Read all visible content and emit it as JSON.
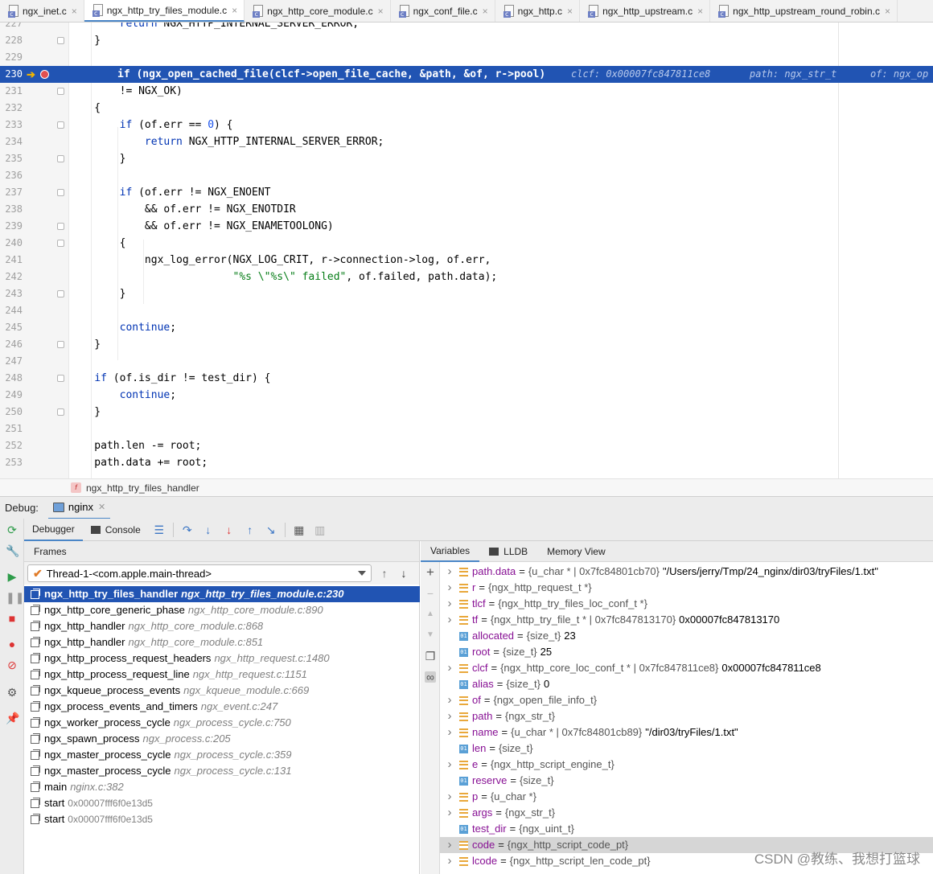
{
  "tabs": [
    {
      "label": "ngx_inet.c",
      "active": false
    },
    {
      "label": "ngx_http_try_files_module.c",
      "active": true
    },
    {
      "label": "ngx_http_core_module.c",
      "active": false
    },
    {
      "label": "ngx_conf_file.c",
      "active": false
    },
    {
      "label": "ngx_http.c",
      "active": false
    },
    {
      "label": "ngx_http_upstream.c",
      "active": false
    },
    {
      "label": "ngx_http_upstream_round_robin.c",
      "active": false
    }
  ],
  "editor": {
    "current_line": "230",
    "current_code": "if (ngx_open_cached_file(clcf->open_file_cache, &path, &of, r->pool)",
    "inline_values": [
      "clcf: 0x00007fc847811ce8",
      "path: ngx_str_t",
      "of: ngx_op"
    ],
    "lines": [
      {
        "n": "227",
        "text": "        return NGX_HTTP_INTERNAL_SERVER_ERROR;"
      },
      {
        "n": "228",
        "text": "    }"
      },
      {
        "n": "229",
        "text": ""
      },
      {
        "n": "230",
        "text": ""
      },
      {
        "n": "231",
        "text": "        != NGX_OK)"
      },
      {
        "n": "232",
        "text": "    {"
      },
      {
        "n": "233",
        "text": "        if (of.err == 0) {"
      },
      {
        "n": "234",
        "text": "            return NGX_HTTP_INTERNAL_SERVER_ERROR;"
      },
      {
        "n": "235",
        "text": "        }"
      },
      {
        "n": "236",
        "text": ""
      },
      {
        "n": "237",
        "text": "        if (of.err != NGX_ENOENT"
      },
      {
        "n": "238",
        "text": "            && of.err != NGX_ENOTDIR"
      },
      {
        "n": "239",
        "text": "            && of.err != NGX_ENAMETOOLONG)"
      },
      {
        "n": "240",
        "text": "        {"
      },
      {
        "n": "241",
        "text": "            ngx_log_error(NGX_LOG_CRIT, r->connection->log, of.err,"
      },
      {
        "n": "242",
        "text": "                          \"%s \\\"%s\\\" failed\", of.failed, path.data);"
      },
      {
        "n": "243",
        "text": "        }"
      },
      {
        "n": "244",
        "text": ""
      },
      {
        "n": "245",
        "text": "        continue;"
      },
      {
        "n": "246",
        "text": "    }"
      },
      {
        "n": "247",
        "text": ""
      },
      {
        "n": "248",
        "text": "    if (of.is_dir != test_dir) {"
      },
      {
        "n": "249",
        "text": "        continue;"
      },
      {
        "n": "250",
        "text": "    }"
      },
      {
        "n": "251",
        "text": ""
      },
      {
        "n": "252",
        "text": "    path.len -= root;"
      },
      {
        "n": "253",
        "text": "    path.data += root;"
      }
    ]
  },
  "breadcrumb": {
    "icon": "f",
    "label": "ngx_http_try_files_handler"
  },
  "debug": {
    "label": "Debug:",
    "session": "nginx",
    "tabs": [
      "Debugger",
      "Console"
    ],
    "frames_title": "Frames",
    "thread": "Thread-1-<com.apple.main-thread>",
    "frames": [
      {
        "fn": "ngx_http_try_files_handler",
        "loc": "ngx_http_try_files_module.c:230",
        "selected": true
      },
      {
        "fn": "ngx_http_core_generic_phase",
        "loc": "ngx_http_core_module.c:890"
      },
      {
        "fn": "ngx_http_handler",
        "loc": "ngx_http_core_module.c:868"
      },
      {
        "fn": "ngx_http_handler",
        "loc": "ngx_http_core_module.c:851"
      },
      {
        "fn": "ngx_http_process_request_headers",
        "loc": "ngx_http_request.c:1480"
      },
      {
        "fn": "ngx_http_process_request_line",
        "loc": "ngx_http_request.c:1151"
      },
      {
        "fn": "ngx_kqueue_process_events",
        "loc": "ngx_kqueue_module.c:669"
      },
      {
        "fn": "ngx_process_events_and_timers",
        "loc": "ngx_event.c:247"
      },
      {
        "fn": "ngx_worker_process_cycle",
        "loc": "ngx_process_cycle.c:750"
      },
      {
        "fn": "ngx_spawn_process",
        "loc": "ngx_process.c:205"
      },
      {
        "fn": "ngx_master_process_cycle",
        "loc": "ngx_process_cycle.c:359"
      },
      {
        "fn": "ngx_master_process_cycle",
        "loc": "ngx_process_cycle.c:131"
      },
      {
        "fn": "main",
        "loc": "nginx.c:382"
      },
      {
        "fn": "start",
        "addr": "0x00007fff6f0e13d5"
      },
      {
        "fn": "start",
        "addr": "0x00007fff6f0e13d5"
      }
    ],
    "var_tabs": [
      "Variables",
      "LLDB",
      "Memory View"
    ],
    "variables": [
      {
        "name": "path.data",
        "type": "{u_char * | 0x7fc84801cb70}",
        "value": "\"/Users/jerry/Tmp/24_nginx/dir03/tryFiles/1.txt\"",
        "expandable": true,
        "kind": "struct"
      },
      {
        "name": "r",
        "type": "{ngx_http_request_t *}",
        "value": "",
        "expandable": true,
        "kind": "struct"
      },
      {
        "name": "tlcf",
        "type": "{ngx_http_try_files_loc_conf_t *}",
        "value": "",
        "expandable": true,
        "kind": "struct"
      },
      {
        "name": "tf",
        "type": "{ngx_http_try_file_t * | 0x7fc847813170}",
        "value": "0x00007fc847813170",
        "expandable": true,
        "kind": "struct"
      },
      {
        "name": "allocated",
        "type": "{size_t}",
        "value": "23",
        "expandable": false,
        "kind": "prim"
      },
      {
        "name": "root",
        "type": "{size_t}",
        "value": "25",
        "expandable": false,
        "kind": "prim"
      },
      {
        "name": "clcf",
        "type": "{ngx_http_core_loc_conf_t * | 0x7fc847811ce8}",
        "value": "0x00007fc847811ce8",
        "expandable": true,
        "kind": "struct"
      },
      {
        "name": "alias",
        "type": "{size_t}",
        "value": "0",
        "expandable": false,
        "kind": "prim"
      },
      {
        "name": "of",
        "type": "{ngx_open_file_info_t}",
        "value": "",
        "expandable": true,
        "kind": "struct"
      },
      {
        "name": "path",
        "type": "{ngx_str_t}",
        "value": "",
        "expandable": true,
        "kind": "struct"
      },
      {
        "name": "name",
        "type": "{u_char * | 0x7fc84801cb89}",
        "value": "\"/dir03/tryFiles/1.txt\"",
        "expandable": true,
        "kind": "struct"
      },
      {
        "name": "len",
        "type": "{size_t}",
        "value": "",
        "expandable": false,
        "kind": "prim"
      },
      {
        "name": "e",
        "type": "{ngx_http_script_engine_t}",
        "value": "",
        "expandable": true,
        "kind": "struct"
      },
      {
        "name": "reserve",
        "type": "{size_t}",
        "value": "",
        "expandable": false,
        "kind": "prim"
      },
      {
        "name": "p",
        "type": "{u_char *}",
        "value": "",
        "expandable": true,
        "kind": "struct"
      },
      {
        "name": "args",
        "type": "{ngx_str_t}",
        "value": "",
        "expandable": true,
        "kind": "struct"
      },
      {
        "name": "test_dir",
        "type": "{ngx_uint_t}",
        "value": "",
        "expandable": false,
        "kind": "prim"
      },
      {
        "name": "code",
        "type": "{ngx_http_script_code_pt}",
        "value": "",
        "expandable": true,
        "kind": "struct",
        "highlight": true
      },
      {
        "name": "lcode",
        "type": "{ngx_http_script_len_code_pt}",
        "value": "",
        "expandable": true,
        "kind": "struct"
      }
    ],
    "prim_badge": "01"
  },
  "watermark": "CSDN @教练、我想打篮球"
}
